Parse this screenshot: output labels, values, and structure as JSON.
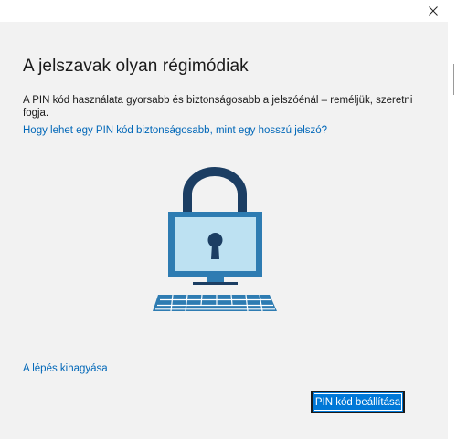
{
  "dialog": {
    "title": "A jelszavak olyan régimódiak",
    "description": "A PIN kód használata gyorsabb és biztonságosabb a jelszóénál – reméljük, szeretni fogja.",
    "help_link": "Hogy lehet egy PIN kód biztonságosabb, mint egy hosszú jelszó?",
    "skip_link": "A lépés kihagyása",
    "primary_button": "PIN kód beállítása"
  },
  "icons": {
    "close": "close-icon",
    "illustration": "padlock-computer-icon"
  },
  "colors": {
    "background": "#f2f2f2",
    "link": "#0067b8",
    "accent": "#0078d7",
    "lock_dark": "#1c3e63",
    "screen_light": "#bde1f2",
    "monitor_frame": "#2e7cb2"
  }
}
